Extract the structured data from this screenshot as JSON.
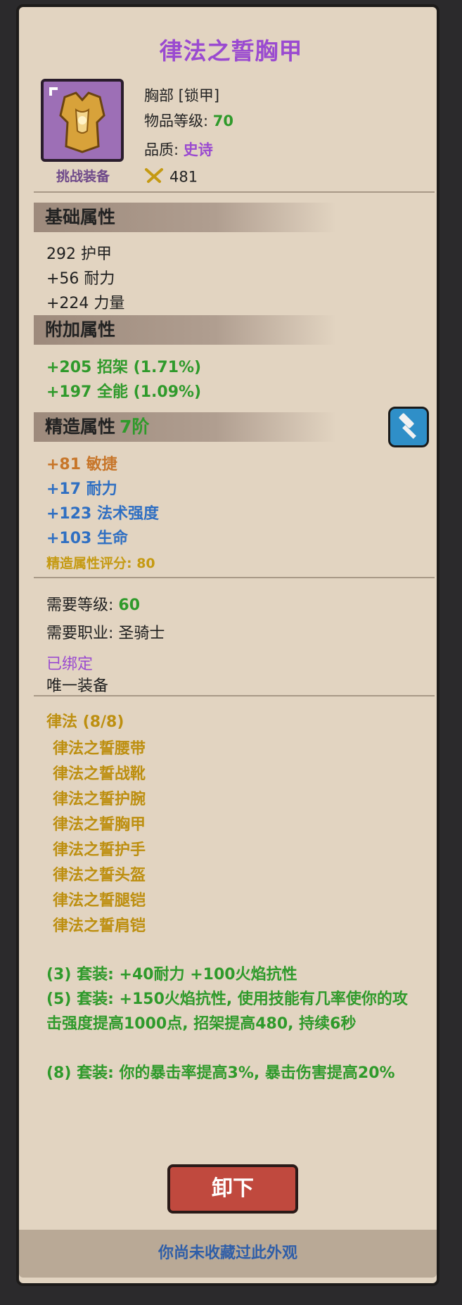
{
  "item": {
    "title": "律法之誓胸甲",
    "icon_name": "chest-armor-icon",
    "icon_tag": "挑战装备",
    "slot": "胸部 [锁甲]",
    "item_level_label": "物品等级: ",
    "item_level": "70",
    "quality_label": "品质: ",
    "quality": "史诗",
    "score_icon": "crossed-swords-icon",
    "score": "481"
  },
  "base": {
    "header": "基础属性",
    "stats": [
      "292 护甲",
      "+56 耐力",
      "+224 力量"
    ]
  },
  "extra": {
    "header": "附加属性",
    "stats": [
      "+205 招架 (1.71%)",
      "+197 全能 (1.09%)"
    ]
  },
  "crafted": {
    "header": "精造属性",
    "tier": "7阶",
    "button_icon": "hammer-icon",
    "stats": [
      "+81 敏捷",
      "+17 耐力",
      "+123 法术强度",
      "+103 生命"
    ],
    "score_label": "精造属性评分: 80"
  },
  "requirements": {
    "level_label": "需要等级: ",
    "level": "60",
    "class": "需要职业: 圣骑士",
    "bound": "已绑定",
    "unique": "唯一装备"
  },
  "set": {
    "name": "律法 (8/8)",
    "pieces": [
      "律法之誓腰带",
      "律法之誓战靴",
      "律法之誓护腕",
      "律法之誓胸甲",
      "律法之誓护手",
      "律法之誓头盔",
      "律法之誓腿铠",
      "律法之誓肩铠"
    ],
    "bonus3": "(3) 套装: +40耐力 +100火焰抗性",
    "bonus5": "(5) 套装: +150火焰抗性, 使用技能有几率使你的攻击强度提高1000点, 招架提高480, 持续6秒",
    "bonus8": "(8) 套装: 你的暴击率提高3%, 暴击伤害提高20%"
  },
  "actions": {
    "unequip": "卸下"
  },
  "footer": "你尚未收藏过此外观",
  "colors": {
    "epic": "#9a4ad0",
    "green": "#2f9a2b",
    "orange": "#c7762a",
    "blue": "#2f6fc2",
    "gold": "#bd8f10",
    "panel": "#e2d4c1"
  }
}
